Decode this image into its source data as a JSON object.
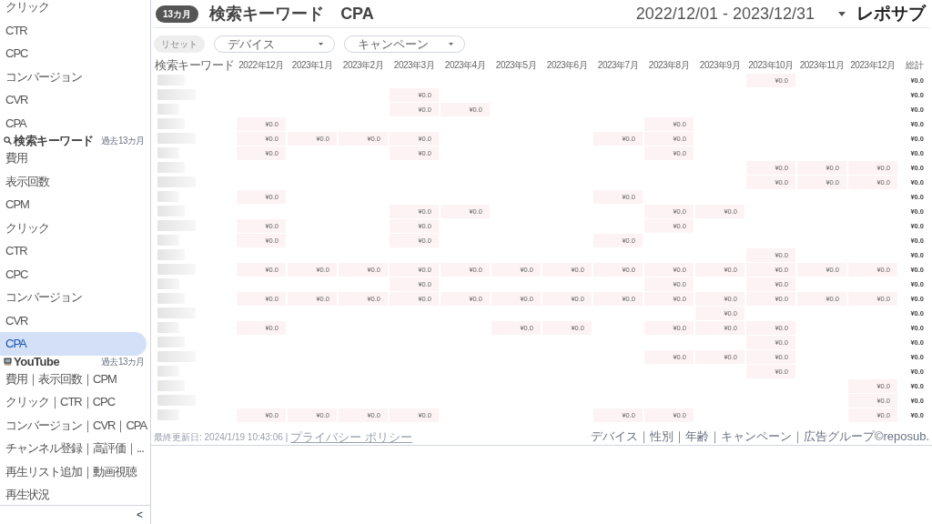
{
  "sidebar": {
    "items": [
      {
        "kind": "item",
        "label": "クリック",
        "selected": false
      },
      {
        "kind": "item",
        "label": "CTR",
        "selected": false
      },
      {
        "kind": "item",
        "label": "CPC",
        "selected": false
      },
      {
        "kind": "item",
        "label": "コンバージョン",
        "selected": false
      },
      {
        "kind": "item",
        "label": "CVR",
        "selected": false
      },
      {
        "kind": "item",
        "label": "CPA",
        "selected": false
      },
      {
        "kind": "section",
        "label": "検索キーワード",
        "period": "過去13カ月"
      },
      {
        "kind": "item",
        "label": "費用",
        "selected": false
      },
      {
        "kind": "item",
        "label": "表示回数",
        "selected": false
      },
      {
        "kind": "item",
        "label": "CPM",
        "selected": false
      },
      {
        "kind": "item",
        "label": "クリック",
        "selected": false
      },
      {
        "kind": "item",
        "label": "CTR",
        "selected": false
      },
      {
        "kind": "item",
        "label": "CPC",
        "selected": false
      },
      {
        "kind": "item",
        "label": "コンバージョン",
        "selected": false
      },
      {
        "kind": "item",
        "label": "CVR",
        "selected": false
      },
      {
        "kind": "item",
        "label": "CPA",
        "selected": true
      },
      {
        "kind": "section",
        "label": "YouTube",
        "period": "過去13カ月"
      },
      {
        "kind": "item",
        "label": "費用｜表示回数｜CPM",
        "selected": false
      },
      {
        "kind": "item",
        "label": "クリック｜CTR｜CPC",
        "selected": false
      },
      {
        "kind": "item",
        "label": "コンバージョン｜CVR｜CPA",
        "selected": false
      },
      {
        "kind": "item",
        "label": "チャンネル登録｜高評価｜...",
        "selected": false
      },
      {
        "kind": "item",
        "label": "再生リスト追加｜動画視聴",
        "selected": false
      },
      {
        "kind": "item",
        "label": "再生状況",
        "selected": false
      }
    ],
    "collapse": "<"
  },
  "header": {
    "badge": "13カ月",
    "title": "検索キーワード　CPA",
    "date_range": "2022/12/01 - 2023/12/31",
    "logo": "レポサブ"
  },
  "filters": {
    "reset": "リセット",
    "dropdowns": [
      {
        "placeholder": "デバイス"
      },
      {
        "placeholder": "キャンペーン"
      }
    ]
  },
  "table": {
    "keyword_header": "検索キーワード",
    "total_header": "総計",
    "columns": [
      "2022年12月",
      "2023年1月",
      "2023年2月",
      "2023年3月",
      "2023年4月",
      "2023年5月",
      "2023年6月",
      "2023年7月",
      "2023年8月",
      "2023年9月",
      "2023年10月",
      "2023年11月",
      "2023年12月"
    ],
    "rows": [
      {
        "cells": [
          null,
          null,
          null,
          null,
          null,
          null,
          null,
          null,
          null,
          null,
          "¥0.0",
          null,
          null
        ],
        "total": "¥0.0"
      },
      {
        "cells": [
          null,
          null,
          null,
          "¥0.0",
          null,
          null,
          null,
          null,
          null,
          null,
          null,
          null,
          null
        ],
        "total": "¥0.0"
      },
      {
        "cells": [
          null,
          null,
          null,
          "¥0.0",
          "¥0.0",
          null,
          null,
          null,
          null,
          null,
          null,
          null,
          null
        ],
        "total": "¥0.0"
      },
      {
        "cells": [
          "¥0.0",
          null,
          null,
          null,
          null,
          null,
          null,
          null,
          "¥0.0",
          null,
          null,
          null,
          null
        ],
        "total": "¥0.0"
      },
      {
        "cells": [
          "¥0.0",
          "¥0.0",
          "¥0.0",
          "¥0.0",
          null,
          null,
          null,
          "¥0.0",
          "¥0.0",
          null,
          null,
          null,
          null
        ],
        "total": "¥0.0"
      },
      {
        "cells": [
          "¥0.0",
          null,
          null,
          "¥0.0",
          null,
          null,
          null,
          null,
          "¥0.0",
          null,
          null,
          null,
          null
        ],
        "total": "¥0.0"
      },
      {
        "cells": [
          null,
          null,
          null,
          null,
          null,
          null,
          null,
          null,
          null,
          null,
          "¥0.0",
          "¥0.0",
          "¥0.0"
        ],
        "total": "¥0.0"
      },
      {
        "cells": [
          null,
          null,
          null,
          null,
          null,
          null,
          null,
          null,
          null,
          null,
          "¥0.0",
          "¥0.0",
          "¥0.0"
        ],
        "total": "¥0.0"
      },
      {
        "cells": [
          "¥0.0",
          null,
          null,
          null,
          null,
          null,
          null,
          "¥0.0",
          null,
          null,
          null,
          null,
          null
        ],
        "total": "¥0.0"
      },
      {
        "cells": [
          null,
          null,
          null,
          "¥0.0",
          "¥0.0",
          null,
          null,
          null,
          "¥0.0",
          "¥0.0",
          null,
          null,
          null
        ],
        "total": "¥0.0"
      },
      {
        "cells": [
          "¥0.0",
          null,
          null,
          "¥0.0",
          null,
          null,
          null,
          null,
          "¥0.0",
          null,
          null,
          null,
          null
        ],
        "total": "¥0.0"
      },
      {
        "cells": [
          "¥0.0",
          null,
          null,
          "¥0.0",
          null,
          null,
          null,
          "¥0.0",
          null,
          null,
          null,
          null,
          null
        ],
        "total": "¥0.0"
      },
      {
        "cells": [
          null,
          null,
          null,
          null,
          null,
          null,
          null,
          null,
          null,
          null,
          "¥0.0",
          null,
          null
        ],
        "total": "¥0.0"
      },
      {
        "cells": [
          "¥0.0",
          "¥0.0",
          "¥0.0",
          "¥0.0",
          "¥0.0",
          "¥0.0",
          "¥0.0",
          "¥0.0",
          "¥0.0",
          "¥0.0",
          "¥0.0",
          "¥0.0",
          "¥0.0"
        ],
        "total": "¥0.0"
      },
      {
        "cells": [
          null,
          null,
          null,
          "¥0.0",
          null,
          null,
          null,
          null,
          "¥0.0",
          null,
          "¥0.0",
          null,
          null
        ],
        "total": "¥0.0"
      },
      {
        "cells": [
          "¥0.0",
          "¥0.0",
          "¥0.0",
          "¥0.0",
          "¥0.0",
          "¥0.0",
          "¥0.0",
          "¥0.0",
          "¥0.0",
          "¥0.0",
          "¥0.0",
          "¥0.0",
          "¥0.0"
        ],
        "total": "¥0.0"
      },
      {
        "cells": [
          null,
          null,
          null,
          null,
          null,
          null,
          null,
          null,
          null,
          "¥0.0",
          null,
          null,
          null
        ],
        "total": "¥0.0"
      },
      {
        "cells": [
          "¥0.0",
          null,
          null,
          null,
          null,
          "¥0.0",
          "¥0.0",
          null,
          "¥0.0",
          "¥0.0",
          "¥0.0",
          null,
          null
        ],
        "total": "¥0.0"
      },
      {
        "cells": [
          null,
          null,
          null,
          null,
          null,
          null,
          null,
          null,
          null,
          null,
          "¥0.0",
          null,
          null
        ],
        "total": "¥0.0"
      },
      {
        "cells": [
          null,
          null,
          null,
          null,
          null,
          null,
          null,
          null,
          "¥0.0",
          "¥0.0",
          "¥0.0",
          null,
          null
        ],
        "total": "¥0.0"
      },
      {
        "cells": [
          null,
          null,
          null,
          null,
          null,
          null,
          null,
          null,
          null,
          null,
          "¥0.0",
          null,
          null
        ],
        "total": "¥0.0"
      },
      {
        "cells": [
          null,
          null,
          null,
          null,
          null,
          null,
          null,
          null,
          null,
          null,
          null,
          null,
          "¥0.0"
        ],
        "total": "¥0.0"
      },
      {
        "cells": [
          null,
          null,
          null,
          null,
          null,
          null,
          null,
          null,
          null,
          null,
          null,
          null,
          "¥0.0"
        ],
        "total": "¥0.0"
      },
      {
        "cells": [
          "¥0.0",
          "¥0.0",
          "¥0.0",
          "¥0.0",
          null,
          null,
          null,
          "¥0.0",
          "¥0.0",
          null,
          null,
          null,
          "¥0.0"
        ],
        "total": "¥0.0"
      }
    ]
  },
  "footer": {
    "updated": "最終更新日: 2024/1/19 10:43:06",
    "separator": "|",
    "privacy_link": "プライバシー ポリシー",
    "nav": "デバイス｜性別｜年齢｜キャンペーン｜広告グループ©reposub."
  }
}
